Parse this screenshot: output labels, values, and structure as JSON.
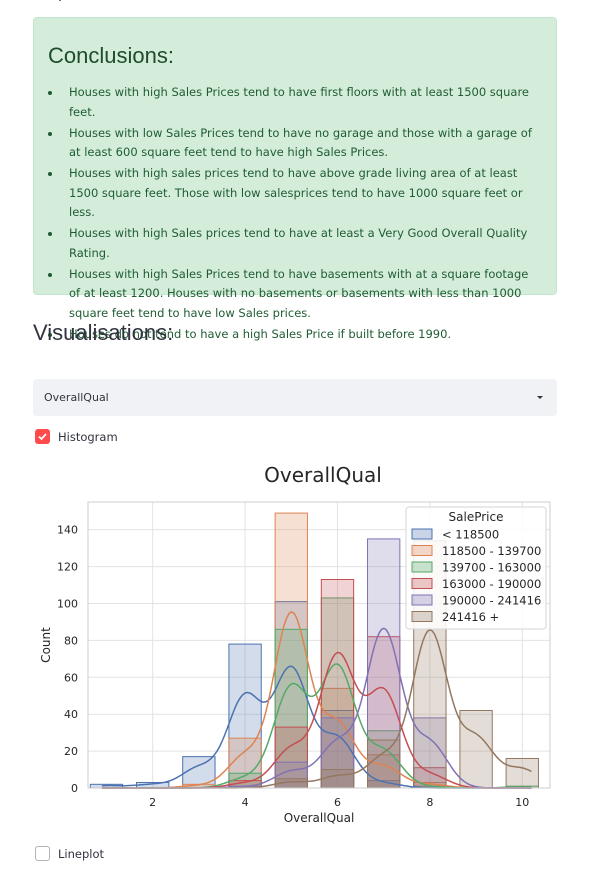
{
  "conclusions": {
    "title": "Conclusions:",
    "items": [
      "Houses with high Sales Prices tend to have first floors with at least 1500 square feet.",
      "Houses with low Sales Prices tend to have no garage and those with a garage of at least 600 square feet tend to have high Sales Prices.",
      "Houses with high sales prices tend to have above grade living area of at least 1500 square feet. Those with low salesprices tend to have 1000 square feet or less.",
      "Houses with high Sales prices tend to have at least a Very Good Overall Quality Rating.",
      "Houses with high Sales Prices tend to have basements with at a square footage of at least 1200. Houses with no basements or basements with less than 1000 square feet tend to have low Sales prices.",
      "Houses do not tend to have a high Sales Price if built before 1990."
    ]
  },
  "visualisations": {
    "title": "Visualisations:",
    "select_value": "OverallQual",
    "histogram_label": "Histogram",
    "histogram_checked": true,
    "lineplot_label": "Lineplot",
    "lineplot_checked": false
  },
  "chart_data": {
    "type": "bar",
    "title": "OverallQual",
    "xlabel": "OverallQual",
    "ylabel": "Count",
    "xlim": [
      0.6,
      10.6
    ],
    "ylim": [
      0,
      155
    ],
    "xticks": [
      2,
      4,
      6,
      8,
      10
    ],
    "yticks": [
      0,
      20,
      40,
      60,
      80,
      100,
      120,
      140
    ],
    "grid": true,
    "legend_title": "SalePrice",
    "legend_position": "top-right",
    "categories": [
      1,
      2,
      3,
      4,
      5,
      6,
      7,
      8,
      9,
      10
    ],
    "series": [
      {
        "name": "< 118500",
        "color": "#4c72b0",
        "values": [
          2,
          3,
          17,
          78,
          101,
          42,
          4,
          0,
          0,
          0
        ]
      },
      {
        "name": "118500 - 139700",
        "color": "#dd8452",
        "values": [
          0,
          0,
          2,
          27,
          149,
          54,
          18,
          3,
          0,
          0
        ]
      },
      {
        "name": "139700 - 163000",
        "color": "#55a868",
        "values": [
          0,
          0,
          0,
          8,
          86,
          103,
          31,
          1,
          0,
          1
        ]
      },
      {
        "name": "163000 - 190000",
        "color": "#c44e52",
        "values": [
          0,
          0,
          0,
          4,
          33,
          113,
          82,
          11,
          0,
          0
        ]
      },
      {
        "name": "190000 - 241416",
        "color": "#8172b3",
        "values": [
          0,
          0,
          0,
          1,
          14,
          38,
          135,
          38,
          0,
          0
        ]
      },
      {
        "name": "241416 +",
        "color": "#937860",
        "values": [
          0,
          0,
          0,
          0,
          5,
          10,
          26,
          134,
          42,
          16
        ]
      }
    ]
  }
}
